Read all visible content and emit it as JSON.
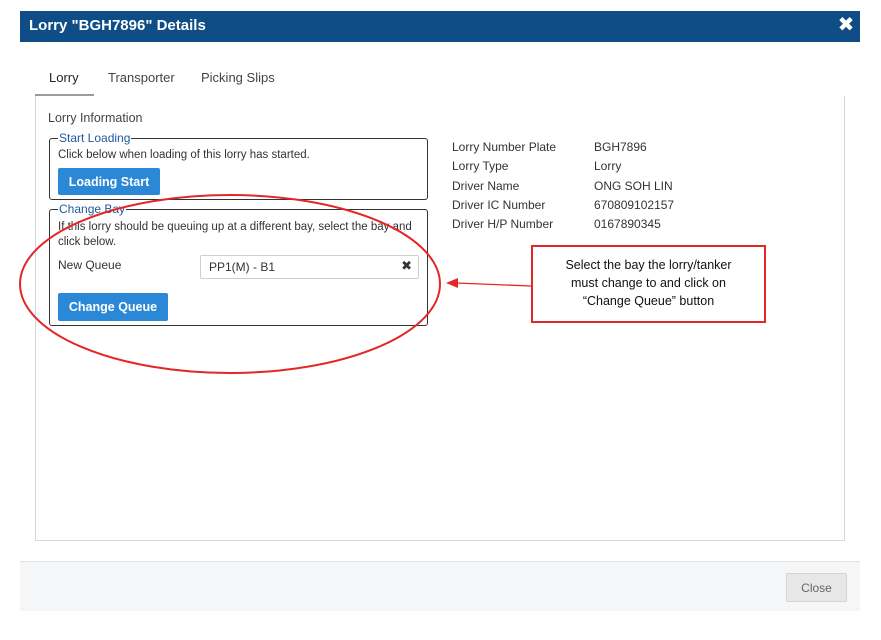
{
  "modal": {
    "title": "Lorry \"BGH7896\" Details",
    "close_icon": "✖"
  },
  "tabs": [
    {
      "label": "Lorry",
      "active": true
    },
    {
      "label": "Transporter",
      "active": false
    },
    {
      "label": "Picking Slips",
      "active": false
    }
  ],
  "section_title": "Lorry Information",
  "start_loading": {
    "legend": "Start Loading",
    "description": "Click below when loading of this lorry has started.",
    "button_label": "Loading Start"
  },
  "change_bay": {
    "legend": "Change Bay",
    "description": "If this lorry should be queuing up at a different bay, select the bay and click below.",
    "new_queue_label": "New Queue",
    "new_queue_value": "PP1(M) - B1",
    "clear_icon": "✖",
    "button_label": "Change Queue"
  },
  "info": [
    {
      "label": "Lorry Number Plate",
      "value": "BGH7896"
    },
    {
      "label": "Lorry Type",
      "value": "Lorry"
    },
    {
      "label": "Driver Name",
      "value": "ONG SOH LIN"
    },
    {
      "label": "Driver IC Number",
      "value": "670809102157"
    },
    {
      "label": "Driver H/P Number",
      "value": "0167890345"
    }
  ],
  "footer": {
    "close_label": "Close"
  },
  "annotation": {
    "line1": "Select the bay the lorry/tanker",
    "line2": "must change to and click on",
    "line3": "“Change Queue” button",
    "color": "#e32727"
  },
  "colors": {
    "header": "#0f4d86",
    "button": "#2a88d6",
    "legend": "#1f5a9a"
  }
}
